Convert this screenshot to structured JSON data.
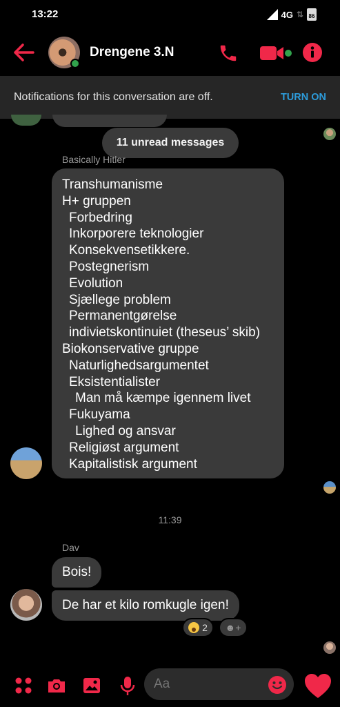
{
  "status": {
    "time": "13:22",
    "network": "4G",
    "battery": "86"
  },
  "header": {
    "title": "Drengene 3.N"
  },
  "notification": {
    "text": "Notifications for this conversation are off.",
    "action": "TURN ON"
  },
  "unread": {
    "label": "11 unread messages"
  },
  "messages": [
    {
      "sender": "Basically Hitler",
      "lines": [
        {
          "text": "Transhumanisme",
          "indent": 0
        },
        {
          "text": "H+ gruppen",
          "indent": 0
        },
        {
          "text": "Forbedring",
          "indent": 1
        },
        {
          "text": "Inkorporere teknologier",
          "indent": 1
        },
        {
          "text": "Konsekvensetikkere.",
          "indent": 1
        },
        {
          "text": "Postegnerism",
          "indent": 1
        },
        {
          "text": "Evolution",
          "indent": 1
        },
        {
          "text": "Sjællege problem",
          "indent": 1
        },
        {
          "text": "Permanentgørelse",
          "indent": 1
        },
        {
          "text": "indivietskontinuiet (theseus’ skib)",
          "indent": 1
        },
        {
          "text": "Biokonservative gruppe",
          "indent": 0
        },
        {
          "text": "Naturlighedsargumentet",
          "indent": 1
        },
        {
          "text": "Eksistentialister",
          "indent": 1
        },
        {
          "text": "Man må kæmpe igennem livet",
          "indent": 2
        },
        {
          "text": "Fukuyama",
          "indent": 1
        },
        {
          "text": "Lighed og ansvar",
          "indent": 2
        },
        {
          "text": "Religiøst argument",
          "indent": 1
        },
        {
          "text": "Kapitalistisk argument",
          "indent": 1
        }
      ]
    }
  ],
  "timestamp": "11:39",
  "second_sender": "Dav",
  "dav_messages": [
    "Bois!",
    "De har et kilo romkugle igen!"
  ],
  "reaction": {
    "emoji": "surprised-face",
    "count": "2"
  },
  "add_reaction_icon": "☻+",
  "composer": {
    "placeholder": "Aa"
  },
  "colors": {
    "accent": "#f02849",
    "bubble": "#3a3a3a",
    "link": "#2d9cdb",
    "online": "#31a24c"
  }
}
